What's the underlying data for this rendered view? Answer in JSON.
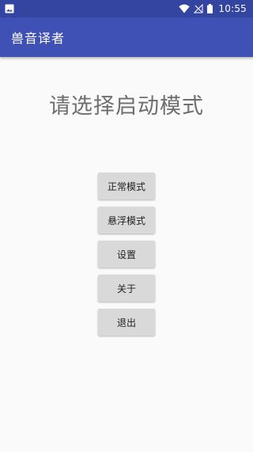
{
  "status_bar": {
    "time": "10:55",
    "icons": [
      "image-notification-icon",
      "wifi-icon",
      "no-signal-icon",
      "battery-icon"
    ],
    "background": "#3345a0"
  },
  "app_bar": {
    "title": "兽音译者",
    "background": "#3f51b5"
  },
  "main": {
    "prompt": "请选择启动模式",
    "buttons": [
      {
        "label": "正常模式"
      },
      {
        "label": "悬浮模式"
      },
      {
        "label": "设置"
      },
      {
        "label": "关于"
      },
      {
        "label": "退出"
      }
    ]
  }
}
